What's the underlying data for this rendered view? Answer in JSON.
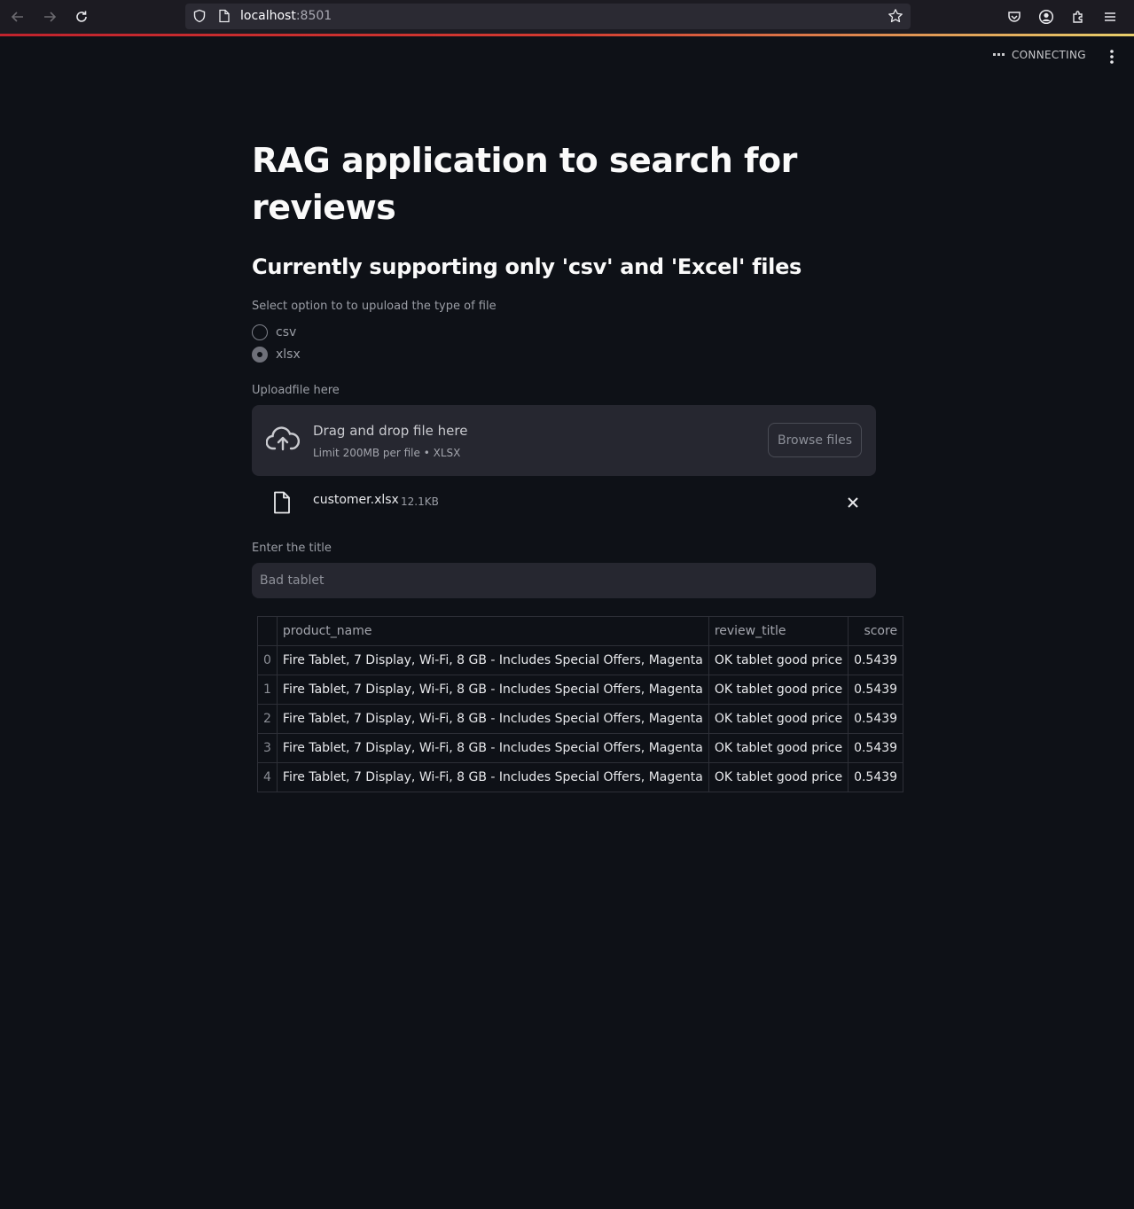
{
  "browser": {
    "url_host": "localhost",
    "url_port": ":8501"
  },
  "status": {
    "text": "CONNECTING"
  },
  "page": {
    "title": "RAG application to search for reviews",
    "subtitle": "Currently supporting only 'csv' and 'Excel' files"
  },
  "file_type": {
    "label": "Select option to to upuload the type of file",
    "options": [
      "csv",
      "xlsx"
    ],
    "selected": "xlsx"
  },
  "uploader": {
    "label": "Uploadfile here",
    "drop_text": "Drag and drop file here",
    "limit_text": "Limit 200MB per file • XLSX",
    "browse_label": "Browse files",
    "file_name": "customer.xlsx",
    "file_size": "12.1KB"
  },
  "title_input": {
    "label": "Enter the title",
    "value": "Bad tablet"
  },
  "results_table": {
    "columns": [
      "",
      "product_name",
      "review_title",
      "score"
    ],
    "rows": [
      [
        "0",
        "Fire Tablet, 7 Display, Wi-Fi, 8 GB - Includes Special Offers, Magenta",
        "OK tablet good price",
        "0.5439"
      ],
      [
        "1",
        "Fire Tablet, 7 Display, Wi-Fi, 8 GB - Includes Special Offers, Magenta",
        "OK tablet good price",
        "0.5439"
      ],
      [
        "2",
        "Fire Tablet, 7 Display, Wi-Fi, 8 GB - Includes Special Offers, Magenta",
        "OK tablet good price",
        "0.5439"
      ],
      [
        "3",
        "Fire Tablet, 7 Display, Wi-Fi, 8 GB - Includes Special Offers, Magenta",
        "OK tablet good price",
        "0.5439"
      ],
      [
        "4",
        "Fire Tablet, 7 Display, Wi-Fi, 8 GB - Includes Special Offers, Magenta",
        "OK tablet good price",
        "0.5439"
      ]
    ]
  },
  "colors": {
    "background": "#0e1117",
    "widget": "#262730",
    "text": "#fafafa",
    "muted": "#9b9ea6"
  }
}
